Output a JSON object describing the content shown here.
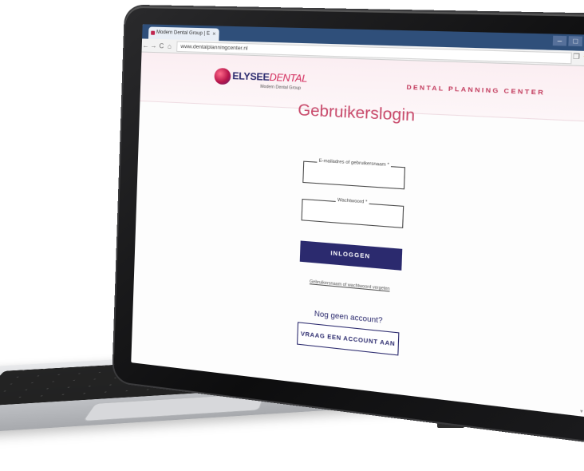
{
  "browser": {
    "tab_title": "Modern Dental Group | E",
    "tab_close": "×",
    "url": "www.dentalplanningcenter.nl",
    "nav": {
      "back": "←",
      "forward": "→",
      "reload": "C",
      "home": "⌂"
    },
    "window_controls": {
      "minimize": "–",
      "maximize": "□",
      "close": "×"
    }
  },
  "header": {
    "logo_brand_a": "ELYSEE",
    "logo_brand_b": "DENTAL",
    "logo_subtitle": "Modern Dental Group",
    "right_title": "DENTAL PLANNING CENTER"
  },
  "login": {
    "title": "Gebruikerslogin",
    "email_label": "E-mailadres of gebruikersnaam *",
    "password_label": "Wachtwoord *",
    "submit_label": "INLOGGEN",
    "forgot_link": "Gebruikersnaam of wachtwoord vergeten",
    "no_account_text": "Nog geen account?",
    "request_account_label": "VRAAG EEN ACCOUNT AAN"
  },
  "colors": {
    "brand_navy": "#2b2a6e",
    "brand_pink": "#c8496a",
    "tab_bar": "#2f4f7a"
  }
}
